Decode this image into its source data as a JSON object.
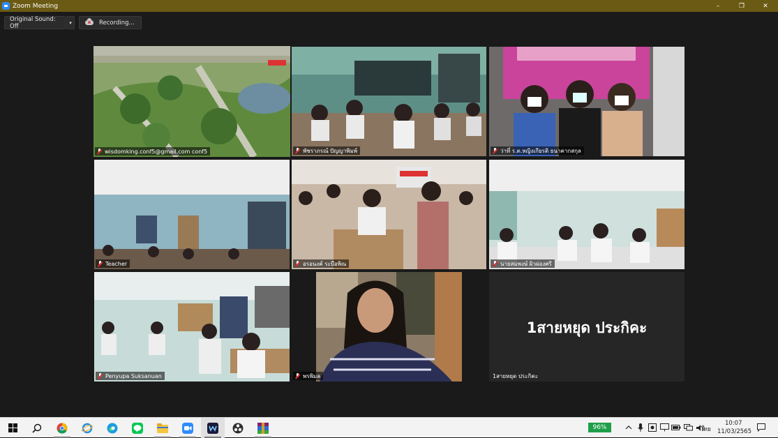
{
  "window": {
    "title": "Zoom Meeting",
    "controls": [
      "–",
      "❐",
      "✕"
    ]
  },
  "toolbar": {
    "original_sound": "Original Sound: Off",
    "caret": "▾",
    "recording": "Recording..."
  },
  "participants": [
    {
      "name": "wisdomking.conf5@gmail.com conf5",
      "muted": true,
      "active_speaker": true
    },
    {
      "name": "พัชราภรณ์  ปัญญาพิมพ์",
      "muted": true
    },
    {
      "name": "ว่าที่ ร.ต.หญิงเกียรติ ธนาคากสกุล",
      "muted": true
    },
    {
      "name": "Teacher",
      "muted": true
    },
    {
      "name": "อรอนงค์  ระบือพิณ",
      "muted": true
    },
    {
      "name": "นายสมพงษ์ ผิวผ่องศรี",
      "muted": true
    },
    {
      "name": "Penyupa Suksanuan",
      "muted": true
    },
    {
      "name": "พรพิมล",
      "muted": true
    },
    {
      "name": "1สายหยุด ประกิคะ",
      "muted": false,
      "video_off": true,
      "display_name": "1สายหยุด ประกิคะ"
    }
  ],
  "taskbar": {
    "battery": "96%",
    "language": "ไทย",
    "time": "10:07",
    "date": "11/03/2565",
    "colors": {
      "accent": "#2d8cff",
      "battery": "#1f9e4a",
      "active_speaker_border": "#c6d83a"
    }
  }
}
